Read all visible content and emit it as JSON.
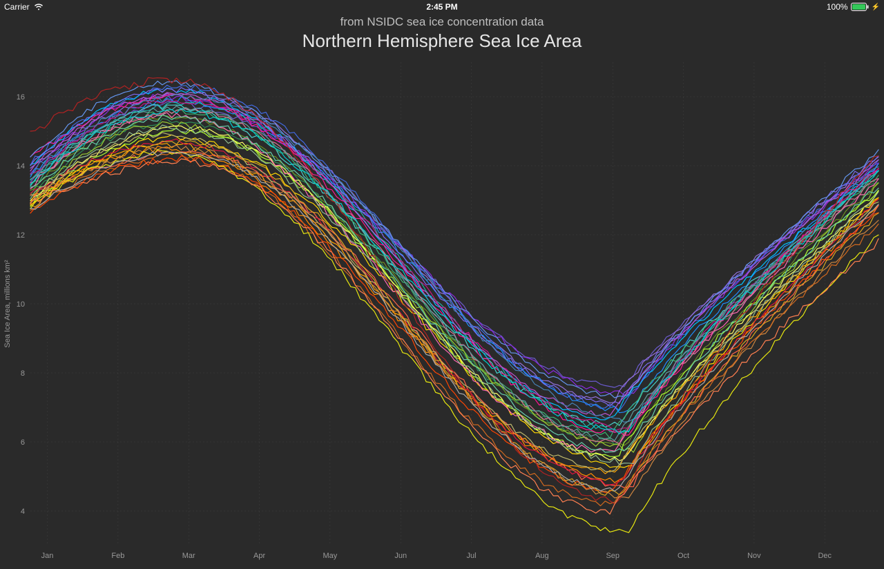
{
  "status_bar": {
    "carrier": "Carrier",
    "time": "2:45 PM",
    "battery_pct": "100%"
  },
  "titles": {
    "subtitle": "from NSIDC sea ice concentration data",
    "title": "Northern Hemisphere Sea Ice Area"
  },
  "chart_data": {
    "type": "line",
    "title": "Northern Hemisphere Sea Ice Area",
    "subtitle": "from NSIDC sea ice concentration data",
    "xlabel": "",
    "ylabel": "Sea Ice Area, millions km²",
    "x_categories": [
      "Jan",
      "Feb",
      "Mar",
      "Apr",
      "May",
      "Jun",
      "Jul",
      "Aug",
      "Sep",
      "Oct",
      "Nov",
      "Dec"
    ],
    "ylim": [
      3,
      17
    ],
    "y_ticks": [
      4,
      6,
      8,
      10,
      12,
      14,
      16
    ],
    "series": [
      {
        "name": "s1",
        "color": "#6a5acd",
        "start": 13.6,
        "peak": 15.8,
        "trough": 7.6,
        "end": 14.0,
        "noise": 0.04
      },
      {
        "name": "s2",
        "color": "#8a2be2",
        "start": 13.8,
        "peak": 16.0,
        "trough": 7.4,
        "end": 14.1,
        "noise": 0.05
      },
      {
        "name": "s3",
        "color": "#9370db",
        "start": 13.9,
        "peak": 16.1,
        "trough": 7.2,
        "end": 14.2,
        "noise": 0.04
      },
      {
        "name": "s4",
        "color": "#4169e1",
        "start": 14.1,
        "peak": 16.3,
        "trough": 7.0,
        "end": 14.2,
        "noise": 0.05
      },
      {
        "name": "s5",
        "color": "#1e90ff",
        "start": 13.7,
        "peak": 15.9,
        "trough": 6.9,
        "end": 14.0,
        "noise": 0.05
      },
      {
        "name": "s6",
        "color": "#00bfff",
        "start": 14.0,
        "peak": 16.2,
        "trough": 6.7,
        "end": 13.9,
        "noise": 0.04
      },
      {
        "name": "s7",
        "color": "#48d1cc",
        "start": 13.5,
        "peak": 15.7,
        "trough": 6.5,
        "end": 13.8,
        "noise": 0.05
      },
      {
        "name": "s8",
        "color": "#20b2aa",
        "start": 13.6,
        "peak": 15.8,
        "trough": 6.3,
        "end": 13.9,
        "noise": 0.04
      },
      {
        "name": "s9",
        "color": "#3cb371",
        "start": 13.4,
        "peak": 15.6,
        "trough": 6.2,
        "end": 13.7,
        "noise": 0.05
      },
      {
        "name": "s10",
        "color": "#2e8b57",
        "start": 13.2,
        "peak": 15.3,
        "trough": 6.0,
        "end": 13.6,
        "noise": 0.05
      },
      {
        "name": "s11",
        "color": "#6b8e23",
        "start": 13.3,
        "peak": 15.4,
        "trough": 5.9,
        "end": 13.5,
        "noise": 0.04
      },
      {
        "name": "s12",
        "color": "#9acd32",
        "start": 13.1,
        "peak": 15.2,
        "trough": 5.8,
        "end": 13.4,
        "noise": 0.05
      },
      {
        "name": "s13",
        "color": "#adff2f",
        "start": 12.9,
        "peak": 15.0,
        "trough": 5.6,
        "end": 13.3,
        "noise": 0.05
      },
      {
        "name": "s14",
        "color": "#ffff66",
        "start": 13.0,
        "peak": 15.1,
        "trough": 5.5,
        "end": 13.2,
        "noise": 0.04
      },
      {
        "name": "s15",
        "color": "#ffd700",
        "start": 12.8,
        "peak": 14.8,
        "trough": 5.3,
        "end": 13.1,
        "noise": 0.05
      },
      {
        "name": "s16",
        "color": "#ffa500",
        "start": 13.0,
        "peak": 14.6,
        "trough": 5.1,
        "end": 13.0,
        "noise": 0.05
      },
      {
        "name": "s17",
        "color": "#ff8c00",
        "start": 12.9,
        "peak": 14.5,
        "trough": 4.9,
        "end": 12.9,
        "noise": 0.05
      },
      {
        "name": "s18",
        "color": "#ff6347",
        "start": 13.1,
        "peak": 14.4,
        "trough": 4.7,
        "end": 12.8,
        "noise": 0.05
      },
      {
        "name": "s19",
        "color": "#ff4500",
        "start": 12.7,
        "peak": 14.2,
        "trough": 4.6,
        "end": 12.7,
        "noise": 0.05
      },
      {
        "name": "s20",
        "color": "#dc143c",
        "start": 13.2,
        "peak": 14.7,
        "trough": 4.8,
        "end": 13.0,
        "noise": 0.04
      },
      {
        "name": "s21",
        "color": "#ff1493",
        "start": 14.2,
        "peak": 16.0,
        "trough": 6.2,
        "end": 14.0,
        "noise": 0.05
      },
      {
        "name": "s22",
        "color": "#ff69b4",
        "start": 13.4,
        "peak": 15.5,
        "trough": 5.7,
        "end": 13.6,
        "noise": 0.05
      },
      {
        "name": "s23",
        "color": "#db7093",
        "start": 13.5,
        "peak": 15.6,
        "trough": 6.0,
        "end": 13.7,
        "noise": 0.04
      },
      {
        "name": "s24",
        "color": "#c71585",
        "start": 13.7,
        "peak": 15.9,
        "trough": 6.4,
        "end": 13.9,
        "noise": 0.05
      },
      {
        "name": "s25",
        "color": "#ba55d3",
        "start": 13.9,
        "peak": 16.1,
        "trough": 6.8,
        "end": 14.1,
        "noise": 0.04
      },
      {
        "name": "s26",
        "color": "#7b68ee",
        "start": 14.0,
        "peak": 16.2,
        "trough": 7.1,
        "end": 14.3,
        "noise": 0.05
      },
      {
        "name": "s27",
        "color": "#6495ed",
        "start": 14.2,
        "peak": 16.4,
        "trough": 7.3,
        "end": 14.4,
        "noise": 0.04
      },
      {
        "name": "s28",
        "color": "#4682b4",
        "start": 13.8,
        "peak": 16.0,
        "trough": 6.6,
        "end": 14.0,
        "noise": 0.05
      },
      {
        "name": "s29",
        "color": "#5f9ea0",
        "start": 13.6,
        "peak": 15.7,
        "trough": 6.1,
        "end": 13.8,
        "noise": 0.04
      },
      {
        "name": "s30",
        "color": "#66cdaa",
        "start": 13.3,
        "peak": 15.4,
        "trough": 5.7,
        "end": 13.4,
        "noise": 0.05
      },
      {
        "name": "s31",
        "color": "#8fbc8f",
        "start": 13.1,
        "peak": 15.1,
        "trough": 5.4,
        "end": 13.2,
        "noise": 0.05
      },
      {
        "name": "s32",
        "color": "#bdb76b",
        "start": 12.9,
        "peak": 14.9,
        "trough": 5.2,
        "end": 13.0,
        "noise": 0.04
      },
      {
        "name": "s33",
        "color": "#daa520",
        "start": 12.8,
        "peak": 14.7,
        "trough": 4.5,
        "end": 12.6,
        "noise": 0.05
      },
      {
        "name": "s34",
        "color": "#cd853f",
        "start": 13.0,
        "peak": 14.5,
        "trough": 4.4,
        "end": 12.5,
        "noise": 0.05
      },
      {
        "name": "s35",
        "color": "#d2691e",
        "start": 12.7,
        "peak": 14.3,
        "trough": 4.2,
        "end": 12.3,
        "noise": 0.05
      },
      {
        "name": "s36",
        "color": "#b22222",
        "start": 14.9,
        "peak": 16.5,
        "trough": 4.3,
        "end": 14.4,
        "noise": 0.06
      },
      {
        "name": "s37",
        "color": "#e7e710",
        "start": 12.8,
        "peak": 14.4,
        "trough": 3.4,
        "end": 12.0,
        "noise": 0.05
      },
      {
        "name": "s38",
        "color": "#ff7f50",
        "start": 12.9,
        "peak": 14.1,
        "trough": 4.0,
        "end": 11.8,
        "noise": 0.05
      },
      {
        "name": "s39",
        "color": "#a9a9a9",
        "start": 12.7,
        "peak": 14.4,
        "trough": 4.6,
        "end": 12.9,
        "noise": 0.04
      },
      {
        "name": "s40",
        "color": "#00ced1",
        "start": 13.5,
        "peak": 15.6,
        "trough": 6.3,
        "end": 13.8,
        "noise": 0.05
      }
    ]
  }
}
